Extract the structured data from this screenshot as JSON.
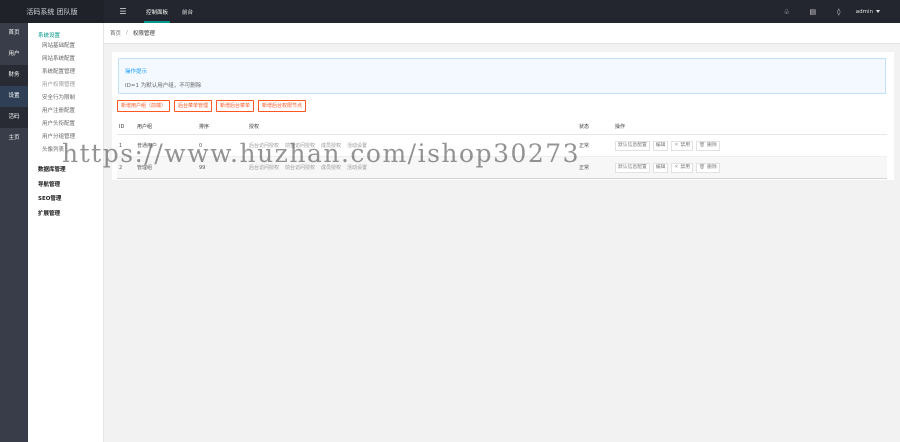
{
  "app": {
    "brand": "活码系统 团队版"
  },
  "topnav": {
    "items": [
      {
        "label": "控制面板",
        "active": true
      },
      {
        "label": "前台",
        "active": false
      }
    ]
  },
  "topright": {
    "user": "admin"
  },
  "leftcol": {
    "items": [
      "首页",
      "用户",
      "财务",
      "设置",
      "活码",
      "主页"
    ]
  },
  "submenu": {
    "group_title": "系统设置",
    "items": [
      "网站基础配置",
      "网站系统配置",
      "系统配置管理",
      "用户权限管理",
      "安全行为限制",
      "用户注册配置",
      "用户头衔配置",
      "用户分组管理",
      "头像列表"
    ],
    "sections": [
      "数据库管理",
      "导航管理",
      "SEO管理",
      "扩展管理"
    ]
  },
  "breadcrumb": {
    "home": "首页",
    "sep": "/",
    "current": "权限管理"
  },
  "tip": {
    "title": "操作提示",
    "text": "ID=1 为默认用户组，不可删除"
  },
  "actions": [
    "新增用户组（前端）",
    "后台菜单管理",
    "新增后台菜单",
    "新增后台权限节点"
  ],
  "table": {
    "headers": {
      "id": "ID",
      "name": "用户组",
      "sort": "排序",
      "auth": "授权",
      "status": "状态",
      "ops": "操作"
    },
    "rows": [
      {
        "id": "1",
        "name": "普通用户",
        "sort": "0",
        "auth": [
          "后台访问授权",
          "前台访问授权",
          "成员授权",
          "活动设置"
        ],
        "status": "正常",
        "ops": [
          "默认信息配置",
          "编辑",
          "禁用",
          "删除"
        ]
      },
      {
        "id": "2",
        "name": "管理组",
        "sort": "99",
        "auth": [
          "后台访问授权",
          "前台访问授权",
          "成员授权",
          "活动设置"
        ],
        "status": "正常",
        "ops": [
          "默认信息配置",
          "编辑",
          "禁用",
          "删除"
        ]
      }
    ]
  },
  "watermark": "https://www.huzhan.com/ishop30273"
}
